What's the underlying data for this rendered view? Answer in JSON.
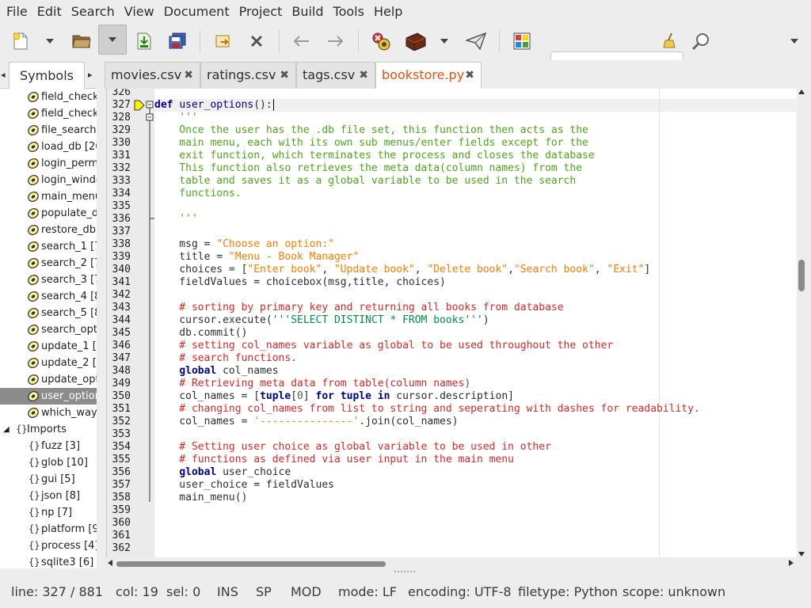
{
  "menubar": {
    "items": [
      "File",
      "Edit",
      "Search",
      "View",
      "Document",
      "Project",
      "Build",
      "Tools",
      "Help"
    ]
  },
  "toolbar": {
    "icons": [
      "new-file-icon",
      "dropdown-arrow-icon",
      "open-folder-icon",
      "recent-dropdown-icon",
      "save-icon",
      "save-all-icon",
      "revert-icon",
      "close-icon",
      "back-arrow-icon",
      "forward-arrow-icon",
      "compile-icon",
      "build-icon",
      "build-dropdown-icon",
      "run-icon",
      "color-chooser-icon",
      "clear-search-icon",
      "find-icon",
      "overflow-dropdown-icon"
    ],
    "search_value": ""
  },
  "sidebar": {
    "tab_label": "Symbols",
    "functions": [
      "field_check",
      "field_check",
      "file_search",
      "load_db [26",
      "login_permi",
      "login_windo",
      "main_menu",
      "populate_dl",
      "restore_db",
      "search_1 [7",
      "search_2 [7",
      "search_3 [7",
      "search_4 [8",
      "search_5 [8",
      "search_opti",
      "update_1 [5",
      "update_2 [5",
      "update_opt",
      "user_option",
      "which_way"
    ],
    "selected_index": 18,
    "imports_label": "Imports",
    "imports": [
      "fuzz [3]",
      "glob [10]",
      "gui [5]",
      "json [8]",
      "np [7]",
      "platform [9",
      "process [4]",
      "sqlite3 [6]"
    ]
  },
  "doc_tabs": [
    {
      "label": "movies.csv",
      "active": false
    },
    {
      "label": "ratings.csv",
      "active": false
    },
    {
      "label": "tags.csv",
      "active": false
    },
    {
      "label": "bookstore.py",
      "active": true
    }
  ],
  "editor": {
    "line_numbers": [
      "326",
      "327",
      "328",
      "329",
      "330",
      "331",
      "332",
      "333",
      "334",
      "335",
      "336",
      "337",
      "338",
      "339",
      "340",
      "341",
      "342",
      "343",
      "344",
      "345",
      "346",
      "347",
      "348",
      "349",
      "350",
      "351",
      "352",
      "353",
      "354",
      "355",
      "356",
      "357",
      "358",
      "359",
      "360",
      "361",
      "362"
    ],
    "current_line": "327",
    "code": {
      "l327_kw": "def",
      "l327_fn": "user_options",
      "l327_rest": "():",
      "l328": "    '''",
      "l329": "    Once the user has the .db file set, this function then acts as the",
      "l330": "    main menu, each with its own sub menus/enter fields except for the",
      "l331": "    exit function, which terminates the process and closes the database",
      "l332": "    This function also retrieves the meta data(column names) from the",
      "l333": "    table and saves it as a global variable to be used in the search",
      "l334": "    functions.",
      "l336": "    '''",
      "l338_a": "    msg = ",
      "l338_s": "\"Choose an option:\"",
      "l339_a": "    title = ",
      "l339_s": "\"Menu - Book Manager\"",
      "l340_a": "    choices = [",
      "l340_s1": "\"Enter book\"",
      "l340_c1": ", ",
      "l340_s2": "\"Update book\"",
      "l340_c2": ", ",
      "l340_s3": "\"Delete book\"",
      "l340_c3": ",",
      "l340_s4": "\"Search book\"",
      "l340_c4": ", ",
      "l340_s5": "\"Exit\"",
      "l340_e": "]",
      "l341": "    fieldValues = choicebox(msg,title, choices)",
      "l343": "    # sorting by primary key and returning all books from database",
      "l344_a": "    cursor.execute(",
      "l344_s": "'''SELECT DISTINCT * FROM books'''",
      "l344_e": ")",
      "l345": "    db.commit()",
      "l346": "    # setting col_names variable as global to be used throughout the other",
      "l347": "    # search functions.",
      "l348_kw": "global",
      "l348_e": " col_names",
      "l349": "    # Retrieving meta data from table(column names)",
      "l350_a": "    col_names = [",
      "l350_kw1": "tuple",
      "l350_b": "[",
      "l350_n": "0",
      "l350_c": "] ",
      "l350_kw2": "for",
      "l350_d": " ",
      "l350_kw3": "tuple",
      "l350_f": " ",
      "l350_kw4": "in",
      "l350_g": " cursor.description]",
      "l351": "    # changing col_names from list to string and seperating with dashes for readability.",
      "l352_a": "    col_names = ",
      "l352_s": "'---------------'",
      "l352_e": ".join(col_names)",
      "l354": "    # Setting user choice as global variable to be used in other",
      "l355": "    # functions as defined via user input in the main menu",
      "l356_kw": "global",
      "l356_e": " user_choice",
      "l357": "    user_choice = fieldValues",
      "l358": "    main_menu()"
    }
  },
  "statusbar": {
    "line": "line: 327 / 881",
    "col": "col: 19",
    "sel": "sel: 0",
    "ins": "INS",
    "sp": "SP",
    "mod": "MOD",
    "mode": "mode: LF",
    "encoding": "encoding: UTF-8",
    "filetype": "filetype: Python",
    "scope": "scope: unknown"
  }
}
